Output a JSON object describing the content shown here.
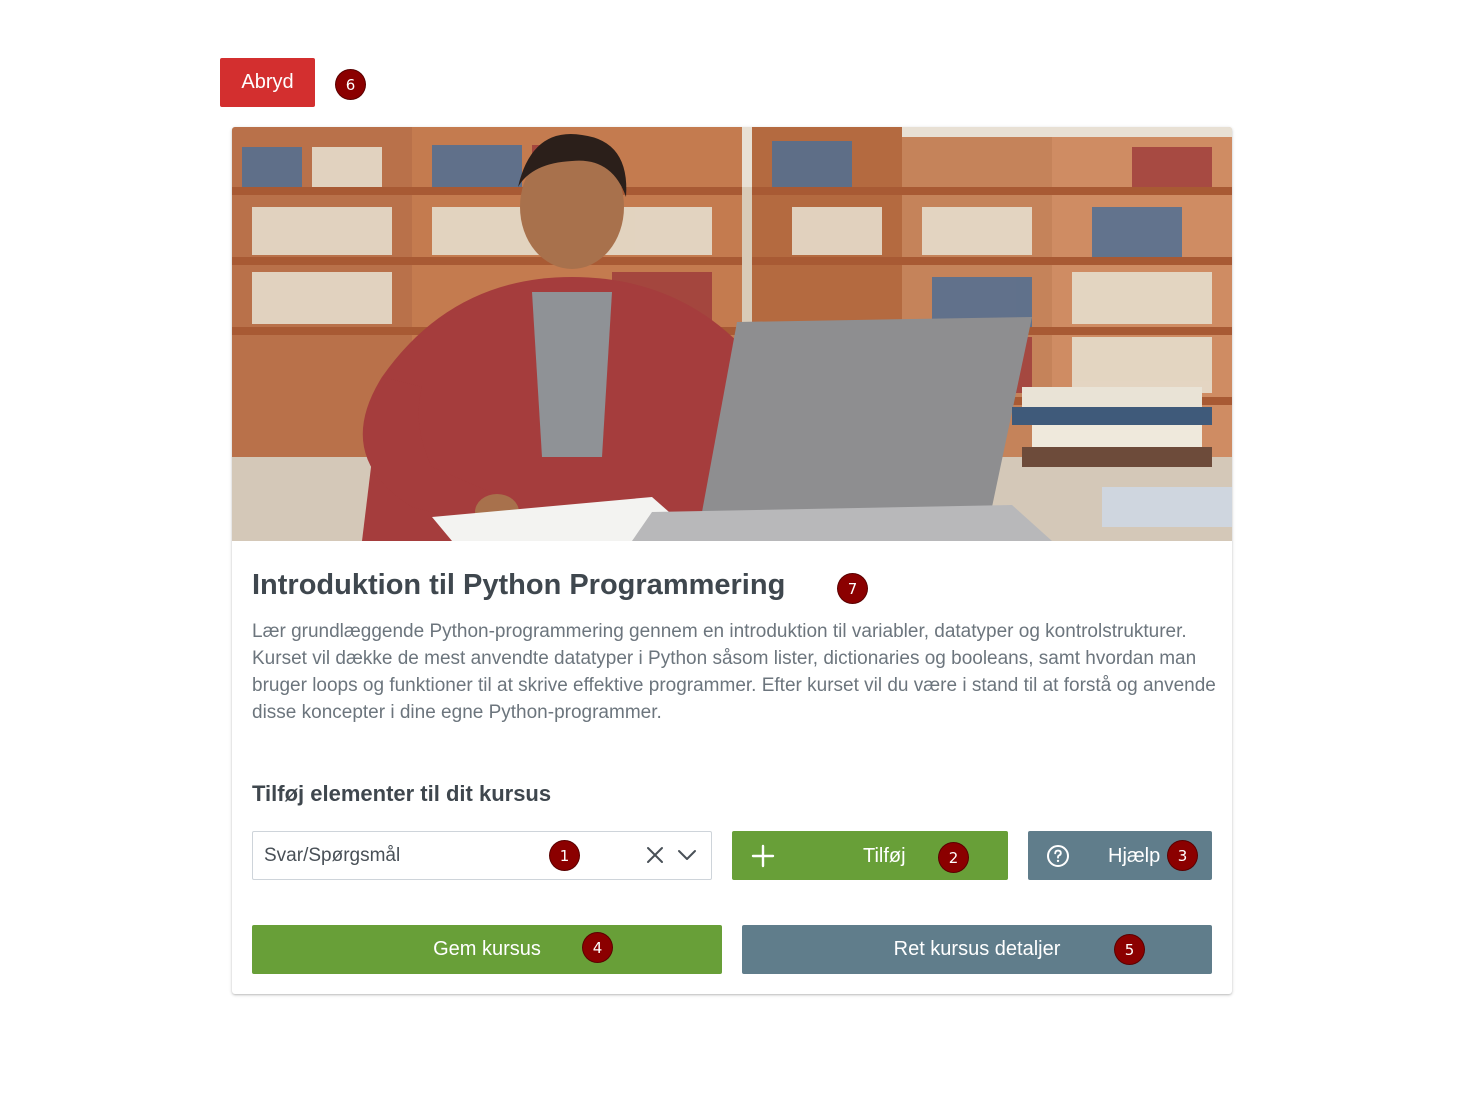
{
  "actions": {
    "abort_label": "Abryd"
  },
  "markers": {
    "m1": "1",
    "m2": "2",
    "m3": "3",
    "m4": "4",
    "m5": "5",
    "m6": "6",
    "m7": "7"
  },
  "course": {
    "title": "Introduktion til Python Programmering",
    "description": "Lær grundlæggende Python-programmering gennem en introduktion til variabler, datatyper og kontrolstrukturer. Kurset vil dække de mest anvendte datatyper i Python såsom lister, dictionaries og booleans, samt hvordan man bruger loops og funktioner til at skrive effektive programmer. Efter kurset vil du være i stand til at forstå og anvende disse koncepter i dine egne Python-programmer."
  },
  "elements": {
    "heading": "Tilføj elementer til dit kursus",
    "selected_type": "Svar/Spørgsmål",
    "add_label": "Tilføj",
    "help_label": "Hjælp"
  },
  "footer": {
    "save_label": "Gem kursus",
    "edit_label": "Ret kursus detaljer"
  },
  "colors": {
    "danger": "#d32f2f",
    "success": "#689f38",
    "secondary": "#607d8b",
    "marker": "#8b0000"
  },
  "icons": {
    "clear": "close-icon",
    "dropdown": "chevron-down-icon",
    "add": "plus-icon",
    "help": "question-circle-icon"
  }
}
